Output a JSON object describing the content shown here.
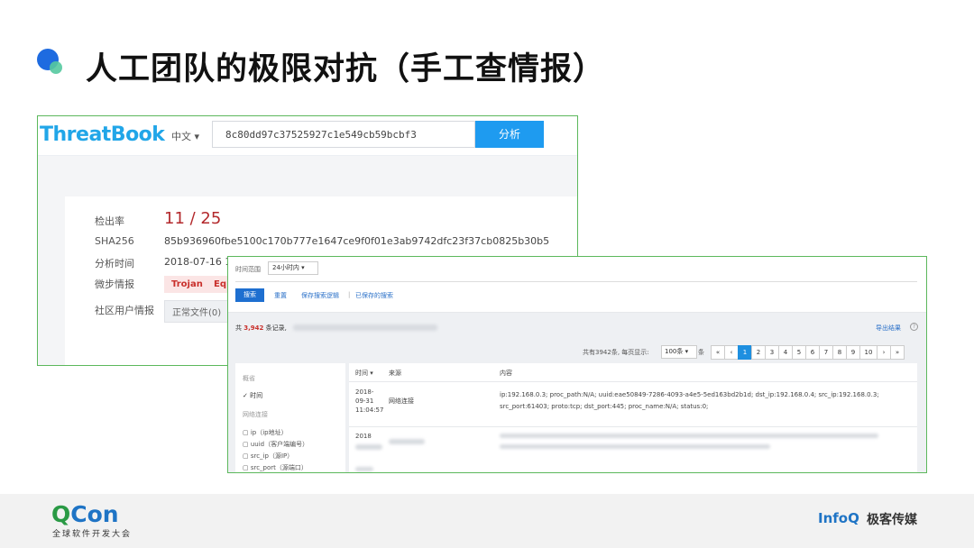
{
  "slide": {
    "title": "人工团队的极限对抗（手工查情报）"
  },
  "threatbook": {
    "logo": "ThreatBook",
    "lang": "中文 ▾",
    "search_value": "8c80dd97c37525927c1e549cb59bcbf3",
    "upload_icon": "upload-icon",
    "analyze_label": "分析",
    "detection_label": "检出率",
    "detection_value": "11 / 25",
    "sha_label": "SHA256",
    "sha_value": "85b936960fbe5100c170b777e1647ce9f0f01e3ab9742dfc23f37cb0825b30b5",
    "time_label": "分析时间",
    "time_value": "2018-07-16 13",
    "tags_label": "微步情报",
    "tags": [
      "Trojan",
      "Eq"
    ],
    "community_label": "社区用户情报",
    "community_button": "正常文件(0)",
    "tag_color": "#c9302c",
    "accent": "#1e9bf0"
  },
  "search_ui": {
    "time_range_label": "时间范围",
    "time_range_value": "24小时内 ▾",
    "search_button": "搜索",
    "links": [
      "重置",
      "保存搜索逻辑",
      "|",
      "已保存的搜索"
    ],
    "count_prefix": "共",
    "count_value": "3,942",
    "count_suffix": "条记录,",
    "export_label": "导出结果",
    "help_icon": "help-icon",
    "pager_info": "共有3942条, 每页显示:",
    "page_size": "100条 ▾",
    "page_size_suffix": "条",
    "pages": [
      "«",
      "‹",
      "1",
      "2",
      "3",
      "4",
      "5",
      "6",
      "7",
      "8",
      "9",
      "10",
      "›",
      "»"
    ],
    "active_page": "1",
    "panel": {
      "head1": "概省",
      "item_time": "✓ 时间",
      "head2": "网络连接",
      "fields": [
        "▢ ip（ip地址）",
        "▢ uuid（客户端编号）",
        "▢ src_ip（源IP）",
        "▢ src_port（源端口）"
      ]
    },
    "table": {
      "col_time": "时间 ▾",
      "col_source": "来源",
      "col_content": "内容",
      "row1_time": "2018-\n09-31\n11:04:57",
      "row1_source": "网络连接",
      "row1_content_line1": "ip:192.168.0.3; proc_path:N/A; uuid:eae50849-7286-4093-a4e5-5ed163bd2b1d; dst_ip:192.168.0.4; src_ip:192.168.0.3;",
      "row1_content_line2": "src_port:61403; proto:tcp; dst_port:445; proc_name:N/A; status:0;",
      "row2_time": "2018"
    }
  },
  "footer": {
    "qcon_q": "Q",
    "qcon_rest": "Con",
    "qcon_sub": "全球软件开发大会",
    "infoq": "InfoQ",
    "infoq_cn": "极客传媒"
  }
}
